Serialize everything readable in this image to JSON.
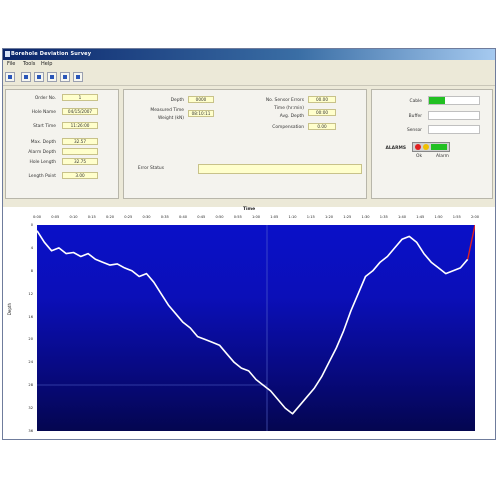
{
  "window": {
    "title": "Borehole Deviation Survey"
  },
  "menu": {
    "items": [
      "File",
      "Tools",
      "Help"
    ]
  },
  "toolbar": {
    "icons": [
      "open-icon",
      "save-icon",
      "print-icon",
      "zoom-icon",
      "settings-icon",
      "exit-icon"
    ]
  },
  "left_panel": {
    "labels": [
      "Order No.",
      "Hole Name",
      "Start Time",
      "Max. Depth",
      "Alarm Depth",
      "Hole Length",
      "Length Point"
    ],
    "values": [
      "1",
      "04/15/2007",
      "11:26:00",
      "32.57",
      "",
      "32.75",
      "3.00"
    ]
  },
  "middle_panel": {
    "left_labels": [
      "Depth",
      "Measured Time",
      "Weight (kN)"
    ],
    "left_values": [
      "0000",
      "08:10:11",
      ""
    ],
    "right_labels": [
      "No. Sensor Errors",
      "Time (hr:min)",
      "Avg. Depth",
      "Compensation"
    ],
    "right_values": [
      "00.00",
      "00:00",
      "00.0",
      "0.00"
    ],
    "status_label": "Error Status",
    "status_value": ""
  },
  "right_panel": {
    "labels": [
      "Cable",
      "Buffer",
      "Sensor",
      "ALARMS"
    ],
    "legend": [
      "Ok",
      "Alarm"
    ]
  },
  "chart": {
    "title": "Time",
    "x_ticks": [
      "0:00",
      "0:05",
      "0:10",
      "0:15",
      "0:20",
      "0:25",
      "0:30",
      "0:35",
      "0:40",
      "0:45",
      "0:50",
      "0:55",
      "1:00",
      "1:05",
      "1:10",
      "1:15",
      "1:20",
      "1:25",
      "1:30",
      "1:35",
      "1:40",
      "1:45",
      "1:50",
      "1:55",
      "2:00"
    ],
    "y_ticks": [
      "0",
      "4",
      "8",
      "12",
      "16",
      "20",
      "24",
      "28",
      "32",
      "36"
    ],
    "y_label": "Depth"
  },
  "colors": {
    "plot_top": "#0a10c8",
    "plot_bottom": "#040650",
    "trace": "#ffffff",
    "alarm_green": "#22c022",
    "alarm_red": "#e02020"
  },
  "chart_data": {
    "type": "line",
    "x": [
      0,
      2,
      4,
      6,
      8,
      10,
      12,
      14,
      16,
      18,
      20,
      22,
      24,
      26,
      28,
      30,
      32,
      34,
      36,
      38,
      40,
      42,
      44,
      46,
      48,
      50,
      52,
      54,
      56,
      58,
      60,
      62,
      64,
      66,
      68,
      70,
      72,
      74,
      76,
      78,
      80,
      82,
      84,
      86,
      88,
      90,
      92,
      94,
      96,
      98,
      100,
      102,
      104,
      106,
      108,
      110,
      112,
      114,
      116,
      118,
      120
    ],
    "y": [
      1,
      3,
      4.5,
      4,
      5,
      4.8,
      5.5,
      5,
      6,
      6.5,
      7,
      6.8,
      7.5,
      8,
      9,
      8.5,
      10,
      12,
      14,
      15.5,
      17,
      18,
      19.5,
      20,
      20.5,
      21,
      22.5,
      24,
      25,
      25.5,
      27,
      28,
      29,
      30.5,
      32,
      33,
      31.5,
      30,
      28.5,
      26.5,
      24,
      21.5,
      18.5,
      15,
      12,
      9,
      8,
      6.5,
      5.5,
      4,
      2.5,
      2,
      3,
      5,
      6.5,
      7.5,
      8.5,
      8,
      7.5,
      6,
      0
    ],
    "ylim": [
      0,
      36
    ],
    "xlim": [
      0,
      120
    ],
    "title": "Time",
    "xlabel": "",
    "ylabel": "Depth"
  }
}
